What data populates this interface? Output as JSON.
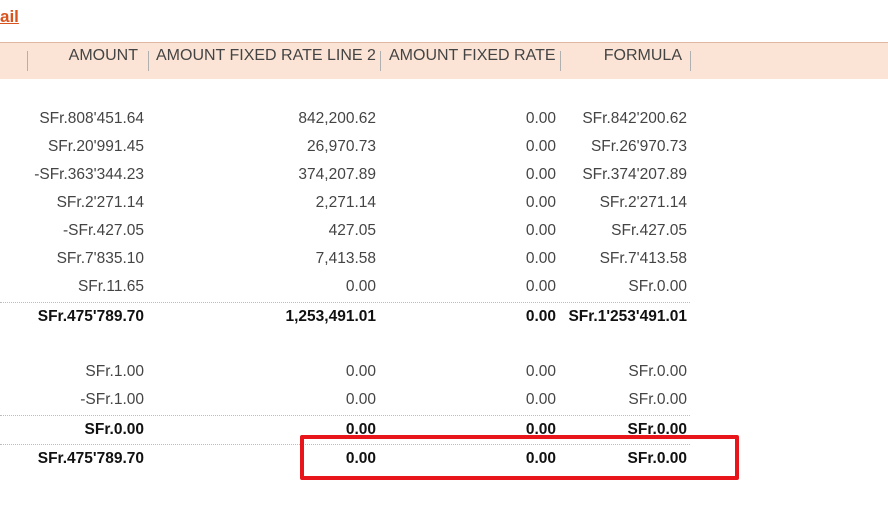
{
  "link": {
    "text": "ail"
  },
  "columns": [
    "AMOUNT",
    "AMOUNT FIXED RATE LINE 2",
    "AMOUNT FIXED RATE",
    "FORMULA"
  ],
  "group1": {
    "rows": [
      [
        "SFr.808'451.64",
        "842,200.62",
        "0.00",
        "SFr.842'200.62"
      ],
      [
        "SFr.20'991.45",
        "26,970.73",
        "0.00",
        "SFr.26'970.73"
      ],
      [
        "-SFr.363'344.23",
        "374,207.89",
        "0.00",
        "SFr.374'207.89"
      ],
      [
        "SFr.2'271.14",
        "2,271.14",
        "0.00",
        "SFr.2'271.14"
      ],
      [
        "-SFr.427.05",
        "427.05",
        "0.00",
        "SFr.427.05"
      ],
      [
        "SFr.7'835.10",
        "7,413.58",
        "0.00",
        "SFr.7'413.58"
      ],
      [
        "SFr.11.65",
        "0.00",
        "0.00",
        "SFr.0.00"
      ]
    ],
    "subtotal": [
      "SFr.475'789.70",
      "1,253,491.01",
      "0.00",
      "SFr.1'253'491.01"
    ]
  },
  "group2": {
    "rows": [
      [
        "SFr.1.00",
        "0.00",
        "0.00",
        "SFr.0.00"
      ],
      [
        "-SFr.1.00",
        "0.00",
        "0.00",
        "SFr.0.00"
      ]
    ],
    "subtotal": [
      "SFr.0.00",
      "0.00",
      "0.00",
      "SFr.0.00"
    ]
  },
  "grand_total": [
    "SFr.475'789.70",
    "0.00",
    "0.00",
    "SFr.0.00"
  ]
}
